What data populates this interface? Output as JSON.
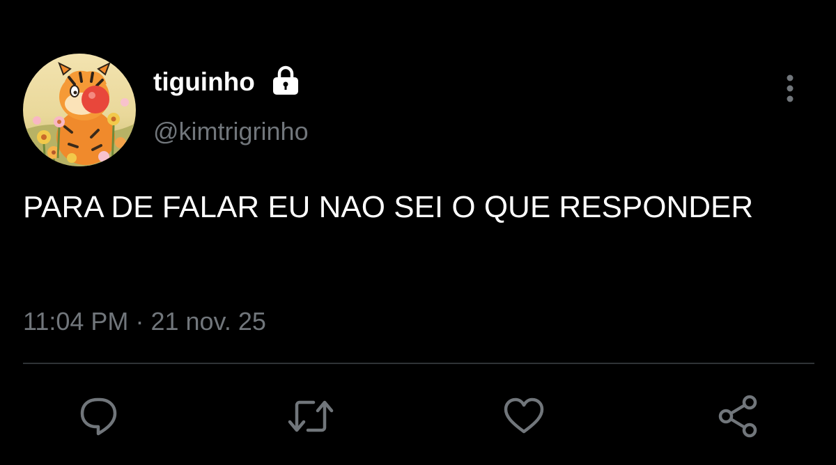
{
  "user": {
    "display_name": "tiguinho",
    "handle": "@kimtrigrinho",
    "protected_icon": "lock-icon",
    "avatar": "tigger-with-flowers-avatar"
  },
  "tweet": {
    "text": "PARA DE FALAR EU NAO SEI O QUE RESPONDER",
    "time": "11:04 PM",
    "separator": "·",
    "date": "21 nov. 25"
  },
  "header": {
    "more_icon": "vertical-ellipsis-icon"
  },
  "actions": [
    {
      "name": "reply",
      "icon": "speech-bubble-icon"
    },
    {
      "name": "retweet",
      "icon": "retweet-icon"
    },
    {
      "name": "like",
      "icon": "heart-icon"
    },
    {
      "name": "share",
      "icon": "share-icon"
    }
  ],
  "colors": {
    "background": "#000000",
    "text_primary": "#ffffff",
    "text_secondary": "#71767b",
    "divider": "#2f3336",
    "icon": "#71767b"
  }
}
